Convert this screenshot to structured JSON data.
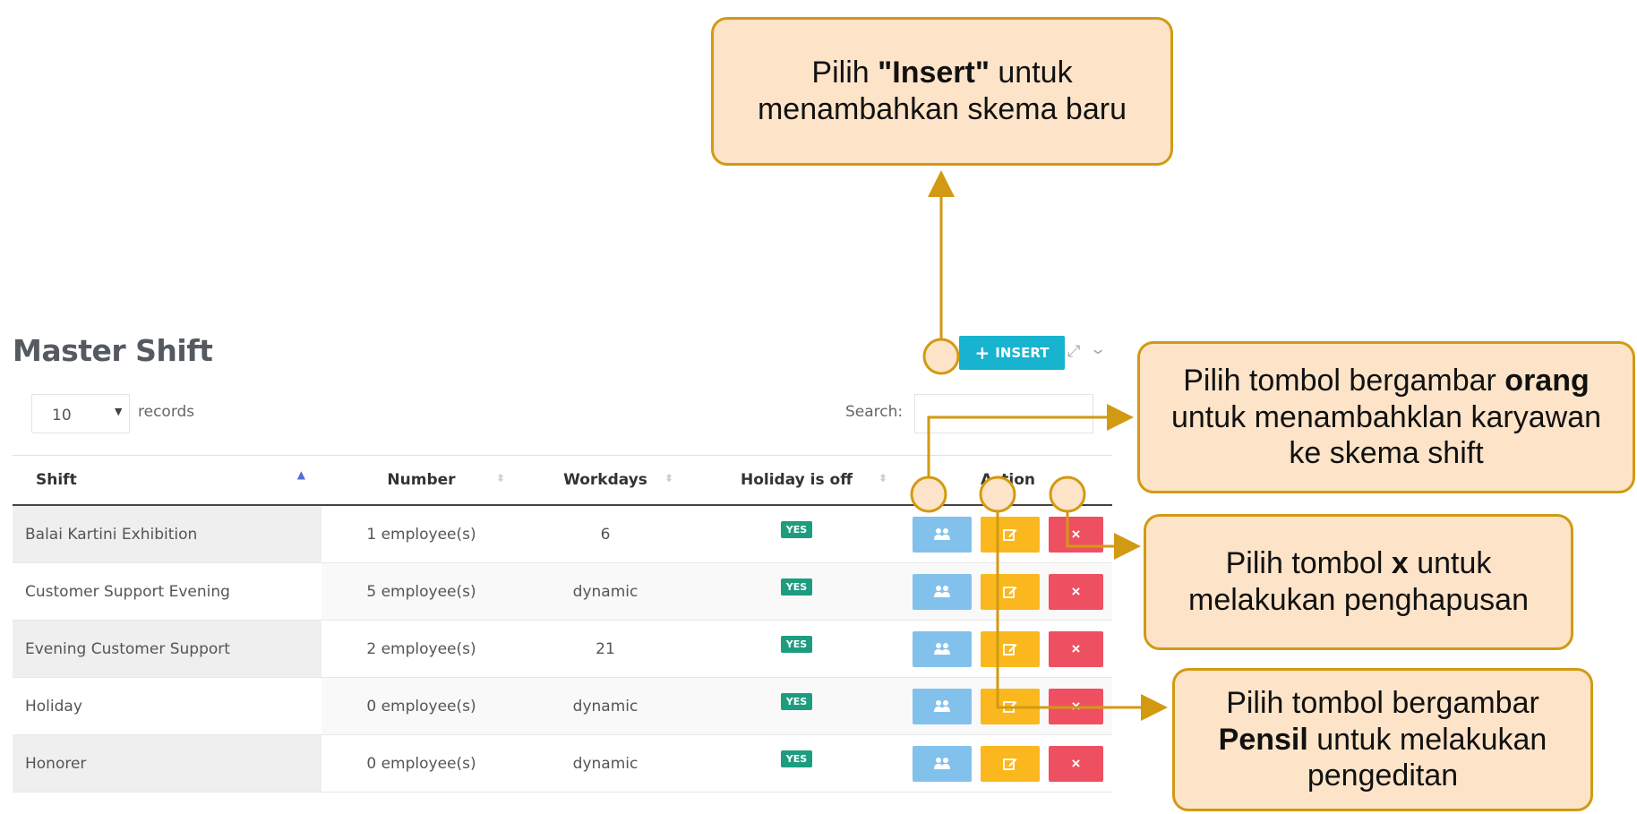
{
  "page": {
    "title": "Master Shift"
  },
  "controls": {
    "records_value": "10",
    "records_label": "records",
    "search_label": "Search:",
    "search_value": "",
    "insert_label": "INSERT"
  },
  "table": {
    "columns": [
      "Shift",
      "Number",
      "Workdays",
      "Holiday is off",
      "Action"
    ],
    "rows": [
      {
        "shift": "Balai Kartini Exhibition",
        "number": "1 employee(s)",
        "workdays": "6",
        "holiday_off": "YES"
      },
      {
        "shift": "Customer Support Evening",
        "number": "5 employee(s)",
        "workdays": "dynamic",
        "holiday_off": "YES"
      },
      {
        "shift": "Evening Customer Support",
        "number": "2 employee(s)",
        "workdays": "21",
        "holiday_off": "YES"
      },
      {
        "shift": "Holiday",
        "number": "0 employee(s)",
        "workdays": "dynamic",
        "holiday_off": "YES"
      },
      {
        "shift": "Honorer",
        "number": "0 employee(s)",
        "workdays": "dynamic",
        "holiday_off": "YES"
      }
    ],
    "delete_symbol": "×"
  },
  "callouts": {
    "insert": {
      "pre": "Pilih ",
      "bold": "\"Insert\"",
      "post": " untuk menambahkan skema baru"
    },
    "people": {
      "pre": "Pilih tombol bergambar ",
      "bold": "orang",
      "post": " untuk menambahklan karyawan ke skema shift"
    },
    "delete": {
      "pre": "Pilih tombol ",
      "bold": "x",
      "post": " untuk melakukan penghapusan"
    },
    "edit": {
      "pre": "Pilih tombol bergambar ",
      "bold": "Pensil",
      "post": " untuk melakukan pengeditan"
    }
  },
  "colors": {
    "insert_button": "#17b3cf",
    "people_button": "#82c1ec",
    "edit_button": "#fab81e",
    "delete_button": "#ee5062",
    "badge": "#1d9d7f",
    "callout_fill": "#fde3c8",
    "callout_border": "#d29a12"
  },
  "icons": {
    "insert": "plus-icon",
    "people": "users-icon",
    "edit": "pencil-square-icon",
    "delete": "close-icon",
    "expand": "expand-icon",
    "collapse": "chevron-down-icon"
  }
}
